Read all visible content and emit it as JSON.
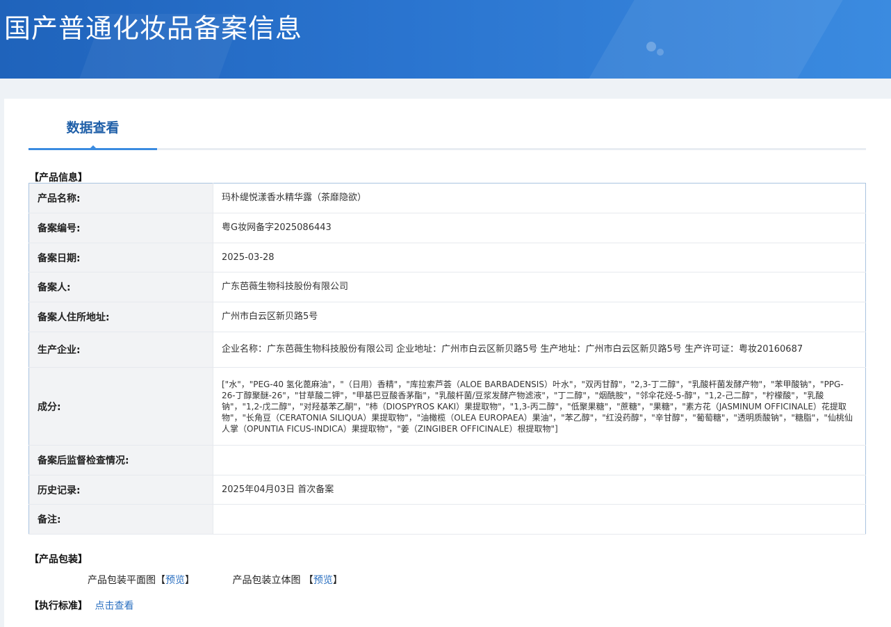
{
  "header": {
    "title": "国产普通化妆品备案信息"
  },
  "tabs": [
    {
      "label": "数据查看"
    }
  ],
  "product_info": {
    "section_title": "【产品信息】",
    "rows": [
      {
        "label": "产品名称:",
        "value": "玛朴缇悦漾香水精华露（茶靡隐欲）"
      },
      {
        "label": "备案编号:",
        "value": "粤G妆网备字2025086443"
      },
      {
        "label": "备案日期:",
        "value": "2025-03-28"
      },
      {
        "label": "备案人:",
        "value": "广东芭薇生物科技股份有限公司"
      },
      {
        "label": "备案人住所地址:",
        "value": "广州市白云区新贝路5号"
      },
      {
        "label": "生产企业:",
        "value": "企业名称：广东芭薇生物科技股份有限公司 企业地址：广州市白云区新贝路5号 生产地址：广州市白云区新贝路5号 生产许可证：粤妆20160687"
      },
      {
        "label": "成分:",
        "value": "[\"水\"，\"PEG-40 氢化蓖麻油\"，\"（日用）香精\"，\"库拉索芦荟（ALOE BARBADENSIS）叶水\"，\"双丙甘醇\"，\"2,3-丁二醇\"，\"乳酸杆菌发酵产物\"，\"苯甲酸钠\"，\"PPG-26-丁醇聚醚-26\"，\"甘草酸二钾\"，\"甲基巴豆酸香茅酯\"，\"乳酸杆菌/豆浆发酵产物滤液\"，\"丁二醇\"，\"烟酰胺\"，\"邻伞花烃-5-醇\"，\"1,2-己二醇\"，\"柠檬酸\"，\"乳酸钠\"，\"1,2-戊二醇\"，\"对羟基苯乙酮\"，\"柿（DIOSPYROS KAKI）果提取物\"，\"1,3-丙二醇\"，\"低聚果糖\"，\"蔗糖\"，\"果糖\"，\"素方花（JASMINUM OFFICINALE）花提取物\"，\"长角豆（CERATONIA SILIQUA）果提取物\"，\"油橄榄（OLEA EUROPAEA）果油\"，\"苯乙醇\"，\"红没药醇\"，\"辛甘醇\"，\"葡萄糖\"，\"透明质酸钠\"，\"糖脂\"，\"仙桃仙人掌（OPUNTIA FICUS-INDICA）果提取物\"，\"姜（ZINGIBER OFFICINALE）根提取物\"]"
      },
      {
        "label": "备案后监督检查情况:",
        "value": ""
      },
      {
        "label": "历史记录:",
        "value": "2025年04月03日 首次备案"
      },
      {
        "label": "备注:",
        "value": ""
      }
    ]
  },
  "packaging": {
    "section_title": "【产品包装】",
    "flat": {
      "label": "产品包装平面图",
      "bracket_open": "【",
      "link": "预览",
      "bracket_close": "】"
    },
    "solid": {
      "label": "产品包装立体图 ",
      "bracket_open": "【",
      "link": "预览",
      "bracket_close": "】"
    }
  },
  "standard": {
    "section_title": "【执行标准】",
    "link": "点击查看"
  }
}
